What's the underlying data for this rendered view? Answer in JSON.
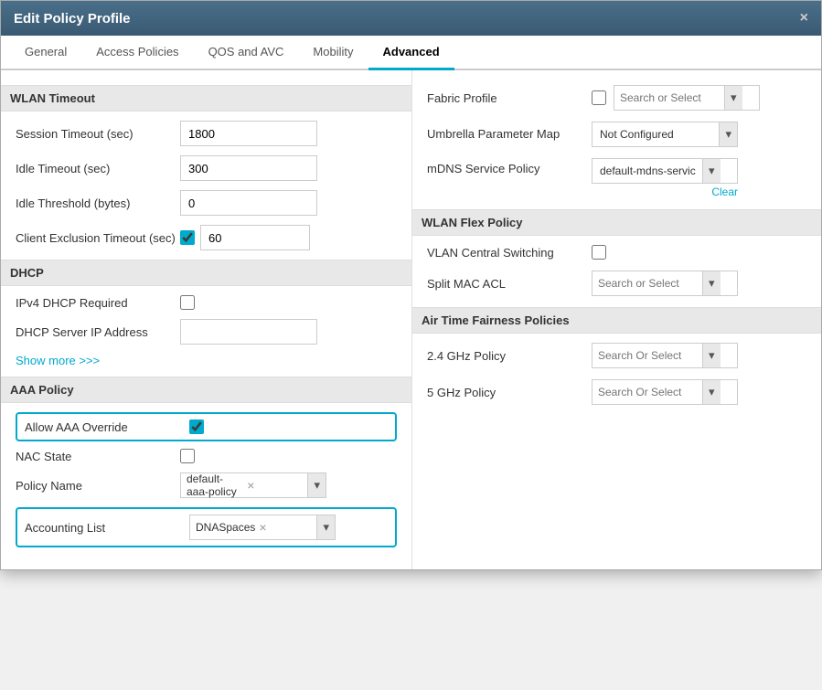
{
  "modal": {
    "title": "Edit Policy Profile",
    "close_label": "×"
  },
  "tabs": [
    {
      "id": "general",
      "label": "General",
      "active": false
    },
    {
      "id": "access-policies",
      "label": "Access Policies",
      "active": false
    },
    {
      "id": "qos-avc",
      "label": "QOS and AVC",
      "active": false
    },
    {
      "id": "mobility",
      "label": "Mobility",
      "active": false
    },
    {
      "id": "advanced",
      "label": "Advanced",
      "active": true
    }
  ],
  "left": {
    "wlan_timeout": {
      "header": "WLAN Timeout",
      "session_label": "Session Timeout (sec)",
      "session_value": "1800",
      "idle_label": "Idle Timeout (sec)",
      "idle_value": "300",
      "threshold_label": "Idle Threshold (bytes)",
      "threshold_value": "0",
      "exclusion_label": "Client Exclusion Timeout (sec)",
      "exclusion_value": "60"
    },
    "dhcp": {
      "header": "DHCP",
      "ipv4_label": "IPv4 DHCP Required",
      "server_label": "DHCP Server IP Address"
    },
    "show_more": "Show more >>>",
    "aaa_policy": {
      "header": "AAA Policy",
      "allow_aaa_label": "Allow AAA Override",
      "nac_state_label": "NAC State",
      "policy_name_label": "Policy Name",
      "policy_name_value": "default-aaa-policy",
      "accounting_list_label": "Accounting List",
      "accounting_list_value": "DNASpaces"
    }
  },
  "right": {
    "fabric_profile": {
      "label": "Fabric Profile",
      "placeholder": "Search or Select"
    },
    "umbrella": {
      "label": "Umbrella Parameter Map",
      "value": "Not Configured"
    },
    "mdns": {
      "label": "mDNS Service Policy",
      "value": "default-mdns-servic",
      "clear_label": "Clear"
    },
    "wlan_flex": {
      "header": "WLAN Flex Policy",
      "vlan_label": "VLAN Central Switching",
      "split_mac_label": "Split MAC ACL",
      "split_mac_placeholder": "Search or Select"
    },
    "air_time": {
      "header": "Air Time Fairness Policies",
      "ghz24_label": "2.4 GHz Policy",
      "ghz24_placeholder": "Search Or Select",
      "ghz5_label": "5 GHz Policy",
      "ghz5_placeholder": "Search Or Select"
    }
  },
  "icons": {
    "dropdown_arrow": "▾",
    "close": "✕",
    "check": "✓"
  }
}
